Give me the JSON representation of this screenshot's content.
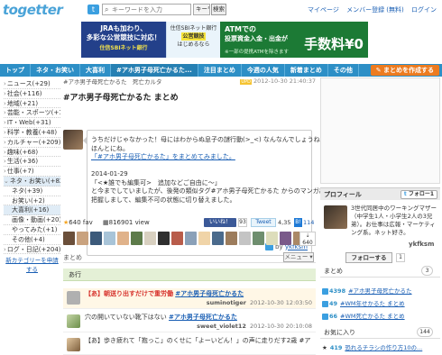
{
  "header": {
    "logo": "togetter",
    "search_placeholder": "キーワードを入力",
    "search_type": "キーワード",
    "search_button": "検索",
    "links": [
      "マイページ",
      "メンバー登録 (無料)",
      "ログイン"
    ]
  },
  "banner": {
    "a_line1": "JRAも加わり、",
    "a_line2": "多彩な公営競技に対応！",
    "a_sub": "住信SBIネット銀行",
    "b_line1": "住信SBIネット銀行",
    "b_hl": "公営競技",
    "b_line3": "はじめるなら",
    "c_line1": "ATMでの",
    "c_line2": "投票資金入金・出金が",
    "c_big": "手数料¥0",
    "c_small": "※一部の提携ATMを除きます"
  },
  "nav": {
    "items": [
      "トップ",
      "ネタ・お笑い",
      "大喜利",
      "#アホ男子母死亡かるた...",
      "注目まとめ",
      "今週の人気",
      "新着まとめ",
      "その他"
    ],
    "create": "まとめを作成する"
  },
  "sidebar": {
    "items": [
      {
        "label": "ニュース(+29)"
      },
      {
        "label": "社会(+116)"
      },
      {
        "label": "地域(+21)"
      },
      {
        "label": "芸能・スポーツ(+119)"
      },
      {
        "label": "IT・Web(+31)"
      },
      {
        "label": "科学・教養(+48)"
      },
      {
        "label": "カルチャー(+209)"
      },
      {
        "label": "趣味(+68)"
      },
      {
        "label": "生活(+36)"
      },
      {
        "label": "仕事(+7)"
      },
      {
        "label": "ネタ・お笑い(+82)"
      },
      {
        "label": "ネタ(+39)"
      },
      {
        "label": "お笑い(+2)"
      },
      {
        "label": "大喜利(+16)"
      },
      {
        "label": "画像・動画(+20)"
      },
      {
        "label": "やってみた(+1)"
      },
      {
        "label": "その他(+4)"
      },
      {
        "label": "ログ・日記(+204)"
      }
    ],
    "suggest": "新カテゴリーを申請する"
  },
  "main": {
    "breadcrumb": "#アホ男子母死亡かるた　死亡カルタ",
    "date": "2012-10-30 21:40:37",
    "title": "#アホ男子母死亡かるた まとめ",
    "desc_lines": [
      "うちだけじゃなかった！母にはわからぬ息子の謎行動(>_<) なんなんでしょうね。",
      "ほんとにね。",
      "「#アホ男子母死亡かるた」をまとめてみました。",
      "",
      "2014-01-29",
      "「<★誰でも編集可>　追加などご自由に〜」",
      "と今までしていましたが、後発の類似タグ#アホ男子母死亡かるた からのマンガ出版化を",
      "把握しまして、編集不可の状態に切り替えました。"
    ],
    "author": "ykfksm",
    "fav_count": "640 fav",
    "view_count": "816901 view",
    "like_label": "いいね！",
    "like_count": "93",
    "tweet_label": "Tweet",
    "tweet_count": "4,35",
    "hb_count": "114",
    "fav_more": "640",
    "matome_label": "まとめ",
    "menu_label": "メニュー",
    "section_label": "あ行",
    "tweets": [
      {
        "prefix": "【あ】朝送り出すだけで重労働",
        "tag": "#アホ男子母死亡かるた",
        "user": "suminotiger",
        "time": "2012-10-30 12:03:50"
      },
      {
        "prefix": "穴の開いていない靴下はない",
        "tag": "#アホ男子母死亡かるた",
        "user": "sweet_violet12",
        "time": "2012-10-30 20:10:08"
      },
      {
        "prefix": "【あ】歩き疲れて「抱っこ」のくせに「よーいどん！」の声に走りだす2歳 #ア",
        "tag": "",
        "user": "",
        "time": ""
      }
    ]
  },
  "right": {
    "profile_label": "プロフィール",
    "follow_label": "フォロー1",
    "profile_desc": "3世代同居中のワーキングマザー（中学生1人・小学生2人の3兄弟）。お仕事は広報・マーケティング系。ネット好き。",
    "profile_name": "ykfksm",
    "follow_btn": "フォローする",
    "follow_count": "1",
    "matome_label": "まとめ",
    "matome_badge": "3",
    "matome_items": [
      {
        "count": "4398",
        "label": "#アホ男子母死亡かるた"
      },
      {
        "count": "49",
        "label": "#WM年せかるた まとめ"
      },
      {
        "count": "66",
        "label": "#WM死亡かるた まとめ"
      }
    ],
    "fav_label": "お気に入り",
    "fav_badge": "144",
    "fav_items": [
      {
        "count": "419",
        "label": "恐れるチラシの作り方10の..."
      }
    ]
  }
}
